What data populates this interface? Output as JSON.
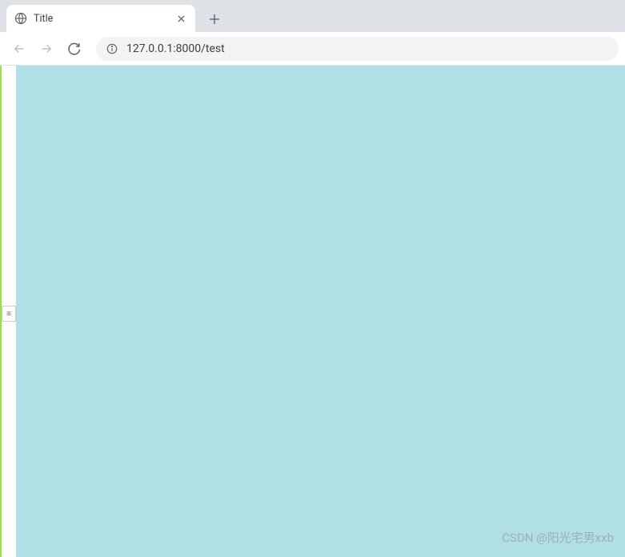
{
  "tab": {
    "title": "Title"
  },
  "address_bar": {
    "url": "127.0.0.1:8000/test"
  },
  "watermark": "CSDN @阳光宅男xxb",
  "colors": {
    "page_background": "#b0e0e6",
    "accent_border": "#9de04e"
  }
}
